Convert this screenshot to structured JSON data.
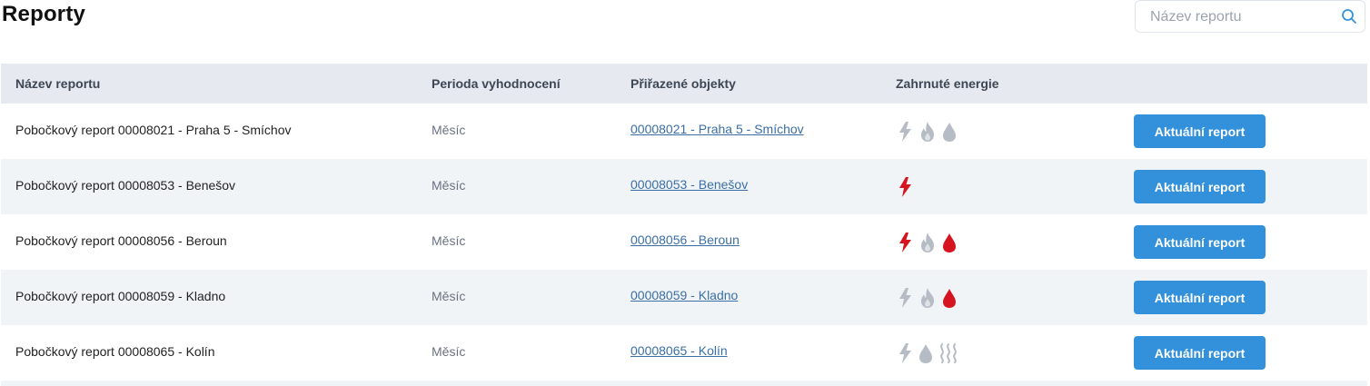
{
  "page": {
    "title": "Reporty"
  },
  "search": {
    "placeholder": "Název reportu",
    "icon": "search-icon"
  },
  "colors": {
    "active_energy": "#d6141f",
    "inactive_energy": "#b5bcc6",
    "button": "#3391dc",
    "link": "#3a6ea5",
    "header_bg": "#e6eaf0"
  },
  "table": {
    "headers": [
      "Název reportu",
      "Perioda vyhodnocení",
      "Přiřazené objekty",
      "Zahrnuté energie"
    ],
    "rows": [
      {
        "name": "Pobočkový report 00008021 - Praha 5 - Smíchov",
        "period": "Měsíc",
        "object": "00008021 - Praha 5 - Smíchov",
        "energies": [
          {
            "icon": "electricity-icon",
            "active": false
          },
          {
            "icon": "gas-flame-icon",
            "active": false
          },
          {
            "icon": "water-drop-icon",
            "active": false
          }
        ],
        "button": "Aktuální report"
      },
      {
        "name": "Pobočkový report 00008053 - Benešov",
        "period": "Měsíc",
        "object": "00008053 - Benešov",
        "energies": [
          {
            "icon": "electricity-icon",
            "active": true
          }
        ],
        "button": "Aktuální report"
      },
      {
        "name": "Pobočkový report 00008056 - Beroun",
        "period": "Měsíc",
        "object": "00008056 - Beroun",
        "energies": [
          {
            "icon": "electricity-icon",
            "active": true
          },
          {
            "icon": "gas-flame-icon",
            "active": false
          },
          {
            "icon": "water-drop-icon",
            "active": true
          }
        ],
        "button": "Aktuální report"
      },
      {
        "name": "Pobočkový report 00008059 - Kladno",
        "period": "Měsíc",
        "object": "00008059 - Kladno",
        "energies": [
          {
            "icon": "electricity-icon",
            "active": false
          },
          {
            "icon": "gas-flame-icon",
            "active": false
          },
          {
            "icon": "water-drop-icon",
            "active": true
          }
        ],
        "button": "Aktuální report"
      },
      {
        "name": "Pobočkový report 00008065 - Kolín",
        "period": "Měsíc",
        "object": "00008065 - Kolín",
        "energies": [
          {
            "icon": "electricity-icon",
            "active": false
          },
          {
            "icon": "water-drop-icon",
            "active": false
          },
          {
            "icon": "heat-waves-icon",
            "active": false
          }
        ],
        "button": "Aktuální report"
      }
    ]
  }
}
